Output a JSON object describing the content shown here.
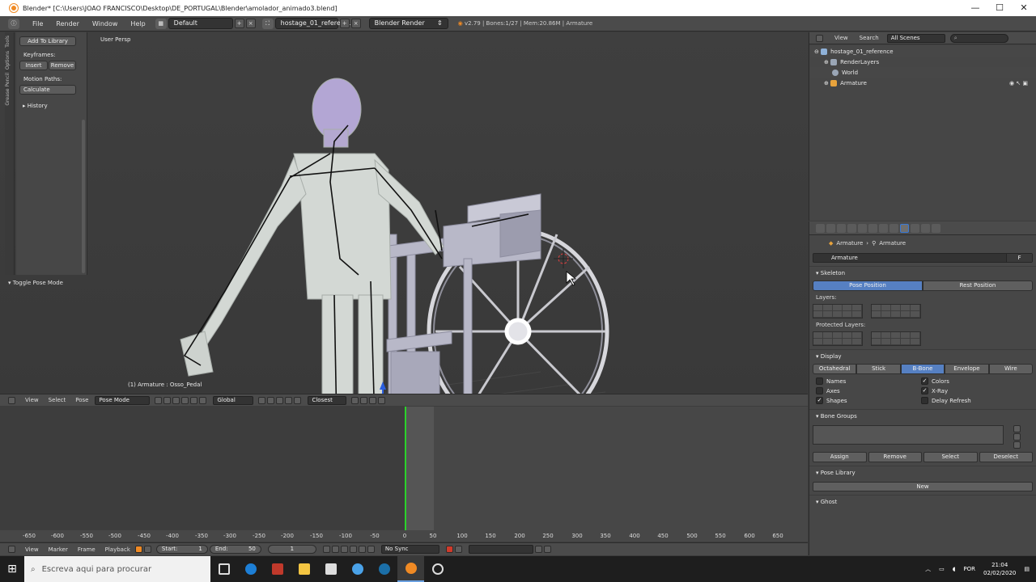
{
  "window": {
    "title": "Blender* [C:\\Users\\JOAO FRANCISCO\\Desktop\\DE_PORTUGAL\\Blender\\amolador_animado3.blend]",
    "controls": [
      "—",
      "☐",
      "✕"
    ]
  },
  "header": {
    "menus": [
      "File",
      "Render",
      "Window",
      "Help"
    ],
    "layout": "Default",
    "scene": "hostage_01_referen...",
    "engine": "Blender Render",
    "stats": "v2.79 | Bones:1/27 | Mem:20.86M | Armature"
  },
  "toolshelf": {
    "tabs": [
      "Tools",
      "Options",
      "Grease Pencil"
    ],
    "add_to_library": "Add To Library",
    "keyframes_label": "Keyframes:",
    "insert": "Insert",
    "remove": "Remove",
    "motion_paths_label": "Motion Paths:",
    "calculate": "Calculate",
    "history": "History",
    "toggle_pose_mode": "Toggle Pose Mode"
  },
  "viewport": {
    "view_label": "User Persp",
    "object_info": "(1) Armature : Osso_Pedal",
    "header": {
      "menus": [
        "View",
        "Select",
        "Pose"
      ],
      "mode": "Pose Mode",
      "orientation": "Global",
      "snap": "Closest"
    }
  },
  "timeline": {
    "ruler": [
      "-650",
      "-600",
      "-550",
      "-500",
      "-450",
      "-400",
      "-350",
      "-300",
      "-250",
      "-200",
      "-150",
      "-100",
      "-50",
      "0",
      "50",
      "100",
      "150",
      "200",
      "250",
      "300",
      "350",
      "400",
      "450",
      "500",
      "550",
      "600",
      "650"
    ],
    "menus": [
      "View",
      "Marker",
      "Frame",
      "Playback"
    ],
    "start_label": "Start:",
    "start": "1",
    "end_label": "End:",
    "end": "50",
    "current": "1",
    "sync": "No Sync",
    "current_frame": 0,
    "frame_range": [
      0,
      50
    ]
  },
  "outliner": {
    "menus": [
      "View",
      "Search"
    ],
    "scene_select": "All Scenes",
    "rows": [
      {
        "label": "hostage_01_reference",
        "color": "#8fb1d8"
      },
      {
        "label": "RenderLayers",
        "color": "#9aa6b6"
      },
      {
        "label": "World",
        "color": "#9aa6b6"
      },
      {
        "label": "Armature",
        "color": "#e8a33c"
      }
    ]
  },
  "properties": {
    "context": [
      "Armature",
      "Armature"
    ],
    "name_field": "Armature",
    "fake_user": "F",
    "skeleton": {
      "title": "Skeleton",
      "pose_position": "Pose Position",
      "rest_position": "Rest Position",
      "layers": "Layers:",
      "protected_layers": "Protected Layers:"
    },
    "display": {
      "title": "Display",
      "modes": [
        "Octahedral",
        "Stick",
        "B-Bone",
        "Envelope",
        "Wire"
      ],
      "active_mode": "B-Bone",
      "checks": [
        {
          "label": "Names",
          "checked": false
        },
        {
          "label": "Colors",
          "checked": true
        },
        {
          "label": "Axes",
          "checked": false
        },
        {
          "label": "X-Ray",
          "checked": true
        },
        {
          "label": "Shapes",
          "checked": true
        },
        {
          "label": "Delay Refresh",
          "checked": false
        }
      ]
    },
    "bone_groups": {
      "title": "Bone Groups",
      "buttons": [
        "Assign",
        "Remove",
        "Select",
        "Deselect"
      ]
    },
    "pose_library": {
      "title": "Pose Library",
      "new": "New"
    },
    "ghost": {
      "title": "Ghost"
    }
  },
  "taskbar": {
    "search_placeholder": "Escreva aqui para procurar",
    "lang": "POR",
    "time": "21:04",
    "date": "02/02/2020"
  },
  "colors": {
    "accent": "#5680c2",
    "playhead": "#2ad22a",
    "blender_orange": "#f08a24"
  }
}
